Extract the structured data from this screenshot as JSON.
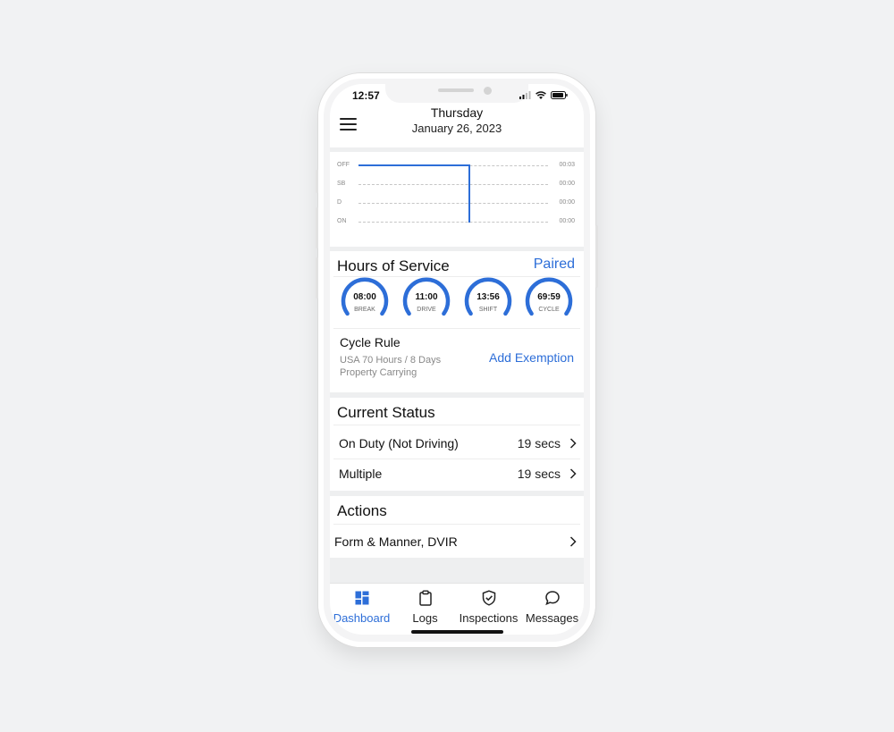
{
  "status_bar": {
    "time": "12:57"
  },
  "header": {
    "day": "Thursday",
    "date": "January 26, 2023"
  },
  "graph": {
    "rows": [
      {
        "label": "OFF",
        "total": "00:03"
      },
      {
        "label": "SB",
        "total": "00:00"
      },
      {
        "label": "D",
        "total": "00:00"
      },
      {
        "label": "ON",
        "total": "00:00"
      }
    ],
    "line_color": "#2d6ed8"
  },
  "hours_of_service": {
    "title": "Hours of Service",
    "paired_label": "Paired",
    "gauges": [
      {
        "value": "08:00",
        "label": "BREAK"
      },
      {
        "value": "11:00",
        "label": "DRIVE"
      },
      {
        "value": "13:56",
        "label": "SHIFT"
      },
      {
        "value": "69:59",
        "label": "CYCLE"
      }
    ],
    "cycle_rule": {
      "title": "Cycle Rule",
      "line1": "USA 70 Hours / 8 Days",
      "line2": "Property Carrying",
      "action": "Add Exemption"
    }
  },
  "current_status": {
    "title": "Current Status",
    "rows": [
      {
        "label": "On Duty (Not Driving)",
        "value": "19 secs"
      },
      {
        "label": "Multiple",
        "value": "19 secs"
      }
    ]
  },
  "actions": {
    "title": "Actions",
    "rows": [
      {
        "label": "Form & Manner, DVIR"
      }
    ]
  },
  "tabbar": {
    "tabs": [
      {
        "label": "Dashboard",
        "icon": "dashboard-icon",
        "active": true
      },
      {
        "label": "Logs",
        "icon": "clipboard-icon",
        "active": false
      },
      {
        "label": "Inspections",
        "icon": "shield-check-icon",
        "active": false
      },
      {
        "label": "Messages",
        "icon": "chat-bubble-icon",
        "active": false
      }
    ]
  },
  "colors": {
    "accent": "#2d6ed8",
    "background": "#f1f2f3"
  }
}
